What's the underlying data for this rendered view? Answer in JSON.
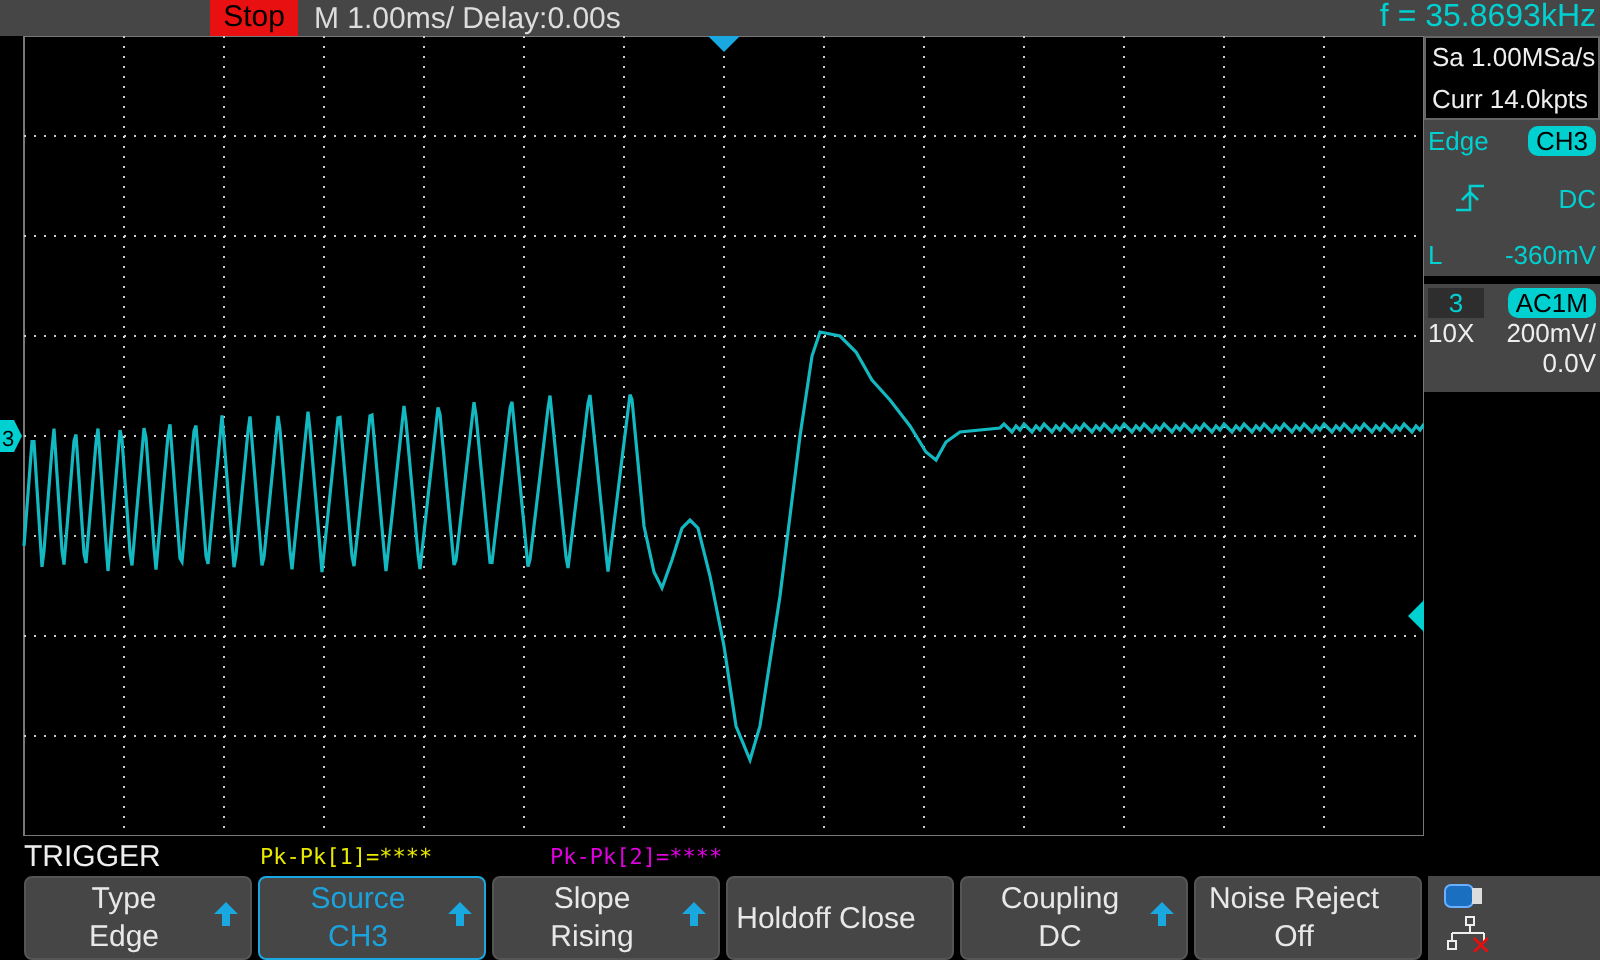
{
  "status": {
    "run_state": "Stop",
    "timebase": "M 1.00ms/ Delay:0.00s",
    "frequency": "f = 35.8693kHz"
  },
  "acquisition": {
    "sample_rate": "Sa 1.00MSa/s",
    "memory": "Curr 14.0kpts"
  },
  "trigger_info": {
    "type": "Edge",
    "source": "CH3",
    "coupling": "DC",
    "level_label": "L",
    "level_value": "-360mV"
  },
  "channel": {
    "number": "3",
    "coupling": "AC1M",
    "probe": "10X",
    "scale": "200mV/",
    "offset": "0.0V"
  },
  "channel_marker": "3",
  "menu": {
    "title": "TRIGGER",
    "buttons": [
      {
        "kind": "two-line",
        "label": "Type",
        "value": "Edge",
        "selected": false,
        "arrow": true
      },
      {
        "kind": "two-line",
        "label": "Source",
        "value": "CH3",
        "selected": true,
        "arrow": true
      },
      {
        "kind": "two-line",
        "label": "Slope",
        "value": "Rising",
        "selected": false,
        "arrow": true
      },
      {
        "kind": "one-line",
        "label": "Holdoff Close",
        "selected": false,
        "arrow": false
      },
      {
        "kind": "two-line",
        "label": "Coupling",
        "value": "DC",
        "selected": false,
        "arrow": true
      },
      {
        "kind": "two-line",
        "label": "Noise Reject",
        "value": "Off",
        "selected": false,
        "arrow": false
      }
    ]
  },
  "measurements": [
    {
      "text": "Pk-Pk[1]=****",
      "color": "#e8e800"
    },
    {
      "text": "Pk-Pk[2]=****",
      "color": "#e000e0"
    }
  ]
}
